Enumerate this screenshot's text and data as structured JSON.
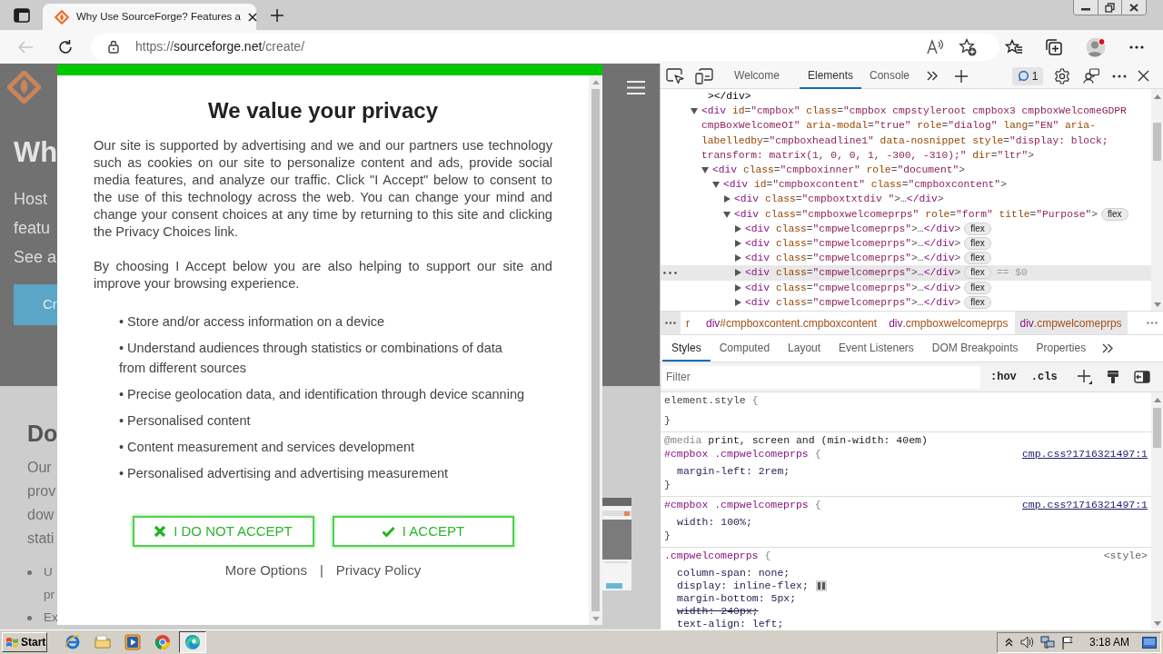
{
  "browser": {
    "tabs": [
      {
        "title": "Why Use SourceForge? Features a",
        "selected": true
      }
    ],
    "back_enabled": false,
    "address": {
      "scheme": "https://",
      "host": "sourceforge.net",
      "path": "/create/"
    }
  },
  "page": {
    "heading": "Wh",
    "intro_lines": [
      "Host",
      "featu",
      "See a"
    ],
    "cta_button": "Cr",
    "section_heading": "Do",
    "section_lines": [
      "Our",
      "prov",
      "dow",
      "stati"
    ],
    "bullets": [
      {
        "lines": [
          "U",
          "pr"
        ]
      },
      {
        "lines": [
          "Ex"
        ]
      }
    ]
  },
  "consent_dialog": {
    "title": "We value your privacy",
    "paragraphs": [
      "Our site is supported by advertising and we and our partners use technology such as cookies on our site to personalize content and ads, provide social media features, and analyze our traffic. Click \"I Accept\" below to consent to the use of this technology across the web. You can change your mind and change your consent choices at any time by returning to this site and clicking the Privacy Choices link.",
      "By choosing I Accept below you are also helping to support our site and improve your browsing experience."
    ],
    "purposes": [
      "• Store and/or access information on a device",
      "• Understand audiences through statistics or combinations of data from different sources",
      "• Precise geolocation data, and identification through device scanning",
      "• Personalised content",
      "• Content measurement and services development",
      "• Personalised advertising and advertising measurement"
    ],
    "buttons": [
      {
        "kind": "reject",
        "label": "I DO NOT ACCEPT"
      },
      {
        "kind": "accept",
        "label": "I ACCEPT"
      }
    ],
    "links": [
      "More Options",
      "Privacy Policy"
    ],
    "link_separator": "|"
  },
  "devtools": {
    "tabs": [
      {
        "label": "Welcome",
        "selected": false
      },
      {
        "label": "Elements",
        "selected": true
      },
      {
        "label": "Console",
        "selected": false
      }
    ],
    "issues_count": "1",
    "dom_tree": [
      {
        "kind": "tail",
        "text": "></div>"
      },
      {
        "kind": "element",
        "text": "<div id=\"cmpbox\" class=\"cmpbox cmpstyleroot cmpbox3 cmpboxWelcomeGDPR cmpBoxWelcomeOI\" aria-modal=\"true\" role=\"dialog\" lang=\"EN\" aria-labelledby=\"cmpboxheadline1\" data-nosnippet style=\"display: block; transform: matrix(1, 0, 0, 1, -300, -310);\" dir=\"ltr\">",
        "expanded": true,
        "selected": false,
        "children": [
          {
            "kind": "element",
            "text": "<div class=\"cmpboxinner\" role=\"document\">",
            "expanded": true,
            "selected": false,
            "children": [
              {
                "kind": "element",
                "text": "<div id=\"cmpboxcontent\" class=\"cmpboxcontent\">",
                "expanded": true,
                "selected": false,
                "children": [
                  {
                    "kind": "element",
                    "text": "<div class=\"cmpboxtxtdiv \">…</div>",
                    "expanded": false,
                    "selected": false
                  },
                  {
                    "kind": "element",
                    "text": "<div class=\"cmpboxwelcomeprps\" role=\"form\" title=\"Purpose\">",
                    "expanded": true,
                    "selected": false,
                    "badge": "flex",
                    "children": [
                      {
                        "kind": "element",
                        "text": "<div class=\"cmpwelcomeprps\">…</div>",
                        "expanded": false,
                        "selected": false,
                        "badge": "flex"
                      },
                      {
                        "kind": "element",
                        "text": "<div class=\"cmpwelcomeprps\">…</div>",
                        "expanded": false,
                        "selected": false,
                        "badge": "flex"
                      },
                      {
                        "kind": "element",
                        "text": "<div class=\"cmpwelcomeprps\">…</div>",
                        "expanded": false,
                        "selected": false,
                        "badge": "flex"
                      },
                      {
                        "kind": "element",
                        "text": "<div class=\"cmpwelcomeprps\">…</div>",
                        "expanded": false,
                        "selected": true,
                        "badge": "flex",
                        "note": "== $0"
                      },
                      {
                        "kind": "element",
                        "text": "<div class=\"cmpwelcomeprps\">…</div>",
                        "expanded": false,
                        "selected": false,
                        "badge": "flex"
                      },
                      {
                        "kind": "element",
                        "text": "<div class=\"cmpwelcomeprps\">…</div>",
                        "expanded": false,
                        "selected": false,
                        "badge": "flex"
                      }
                    ]
                  }
                ]
              }
            ]
          }
        ]
      }
    ],
    "breadcrumbs": [
      {
        "qualifier": "r",
        "selected": false
      },
      {
        "tag": "div",
        "qualifier": "#cmpboxcontent.cmpboxcontent",
        "selected": false
      },
      {
        "tag": "div",
        "qualifier": ".cmpboxwelcomeprps",
        "selected": false
      },
      {
        "tag": "div",
        "qualifier": ".cmpwelcomeprps",
        "selected": true
      }
    ],
    "pane_tabs": [
      {
        "label": "Styles",
        "selected": true
      },
      {
        "label": "Computed",
        "selected": false
      },
      {
        "label": "Layout",
        "selected": false
      },
      {
        "label": "Event Listeners",
        "selected": false
      },
      {
        "label": "DOM Breakpoints",
        "selected": false
      },
      {
        "label": "Properties",
        "selected": false
      }
    ],
    "filter": {
      "placeholder": "Filter"
    },
    "filter_buttons": [
      ":hov",
      ".cls"
    ],
    "rules": [
      {
        "selector": "element.style",
        "open": "{",
        "close": "}"
      },
      {
        "media_keyword": "@media",
        "media_query": "print, screen and (min-width: 40em)",
        "selector": "#cmpbox .cmpwelcomeprps",
        "open": "{",
        "close": "}",
        "source": "cmp.css?1716321497:1",
        "source_is_link": true,
        "declarations": [
          {
            "text": "margin-left: 2rem;",
            "overridden": false,
            "flex_editor": false
          }
        ]
      },
      {
        "selector": "#cmpbox .cmpwelcomeprps",
        "open": "{",
        "close": "}",
        "source": "cmp.css?1716321497:1",
        "source_is_link": true,
        "declarations": [
          {
            "text": "width: 100%;",
            "overridden": false,
            "flex_editor": false
          }
        ]
      },
      {
        "selector": ".cmpwelcomeprps",
        "open": "{",
        "source": "<style>",
        "source_is_link": false,
        "declarations": [
          {
            "text": "column-span: none;",
            "overridden": false,
            "flex_editor": false
          },
          {
            "text": "display: inline-flex;",
            "overridden": false,
            "flex_editor": true
          },
          {
            "text": "margin-bottom: 5px;",
            "overridden": false,
            "flex_editor": false
          },
          {
            "text": "width: 240px;",
            "overridden": true,
            "flex_editor": false
          },
          {
            "text": "text-align: left;",
            "overridden": false,
            "flex_editor": false
          }
        ]
      }
    ]
  },
  "taskbar": {
    "start": "Start",
    "apps": [
      {
        "kind": "ie",
        "selected": false
      },
      {
        "kind": "folder",
        "selected": false
      },
      {
        "kind": "player",
        "selected": false
      },
      {
        "kind": "chrome",
        "selected": false
      },
      {
        "kind": "edge",
        "selected": true
      }
    ],
    "clock": "3:18 AM"
  }
}
